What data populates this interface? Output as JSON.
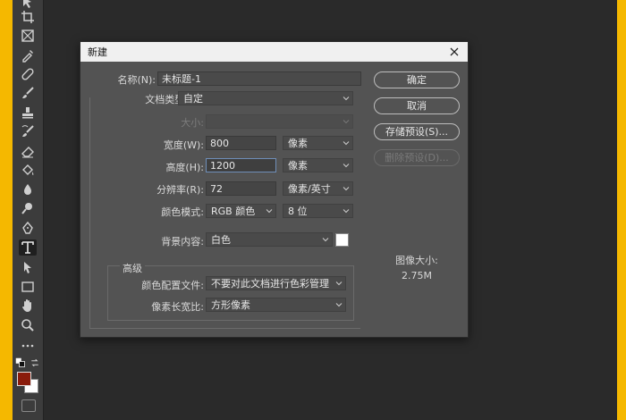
{
  "dialog": {
    "title": "新建",
    "name_label": "名称(N):",
    "name_value": "未标题-1",
    "doc_type_label": "文档类型:",
    "doc_type_value": "自定",
    "size_label": "大小:",
    "size_value": "",
    "width_label": "宽度(W):",
    "width_value": "800",
    "width_unit": "像素",
    "height_label": "高度(H):",
    "height_value": "1200",
    "height_unit": "像素",
    "resolution_label": "分辨率(R):",
    "resolution_value": "72",
    "resolution_unit": "像素/英寸",
    "color_mode_label": "颜色模式:",
    "color_mode_value": "RGB 颜色",
    "bit_depth_value": "8 位",
    "bg_label": "背景内容:",
    "bg_value": "白色",
    "bg_swatch_color": "#ffffff",
    "advanced_label": "高级",
    "profile_label": "颜色配置文件:",
    "profile_value": "不要对此文档进行色彩管理",
    "pixel_aspect_label": "像素长宽比:",
    "pixel_aspect_value": "方形像素",
    "image_size_label": "图像大小:",
    "image_size_value": "2.75M",
    "buttons": {
      "ok": "确定",
      "cancel": "取消",
      "save_preset": "存储预设(S)...",
      "delete_preset": "删除预设(D)..."
    }
  },
  "toolbar": {
    "tools": [
      "move-tool",
      "crop-tool",
      "frame-tool",
      "eyedropper-tool",
      "healing-brush-tool",
      "brush-tool",
      "clone-stamp-tool",
      "history-brush-tool",
      "eraser-tool",
      "paint-bucket-tool",
      "blur-tool",
      "dodge-tool",
      "pen-tool",
      "type-tool",
      "path-selection-tool",
      "rectangle-tool",
      "hand-tool",
      "zoom-tool",
      "more-tools"
    ],
    "active_tool": "type-tool",
    "foreground_color": "#8a1c0c",
    "background_color": "#ffffff"
  },
  "colors": {
    "frame_accent": "#f5b800",
    "dialog_bg": "#535353",
    "canvas_bg": "#2a2a2a"
  }
}
